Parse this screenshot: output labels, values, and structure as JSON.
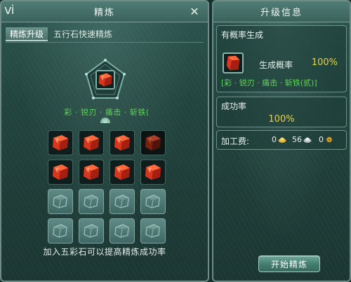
{
  "left_panel": {
    "title": "精炼",
    "tabs": [
      {
        "label": "精炼升级",
        "active": true
      },
      {
        "label": "五行石快速精炼",
        "active": false
      }
    ],
    "target_slot": {
      "item": "red-crystal-stone"
    },
    "target_text": "彩 · 锐刃 · 痛击 · 斩铁(",
    "grid": {
      "rows": [
        [
          "red-crystal-stone",
          "red-crystal-stone",
          "red-crystal-stone",
          "red-crystal-stone-dim"
        ],
        [
          "red-crystal-stone",
          "red-crystal-stone",
          "red-crystal-stone",
          "red-crystal-stone"
        ],
        [
          "empty",
          "empty",
          "empty",
          "empty"
        ],
        [
          "empty",
          "empty",
          "empty",
          "empty"
        ]
      ]
    },
    "hint": "加入五彩石可以提高精炼成功率"
  },
  "right_panel": {
    "title": "升级信息",
    "probability_section": {
      "title": "有概率生成",
      "item": "red-crystal-stone",
      "label": "生成概率",
      "value": "100%",
      "attributes": "[彩 · 锐刃 · 痛击 · 斩铁(贰)]"
    },
    "success_section": {
      "title": "成功率",
      "value": "100%"
    },
    "fee_section": {
      "label": "加工费:",
      "gold": "0",
      "silver": "56",
      "copper": "0"
    },
    "start_button": "开始精炼"
  },
  "colors": {
    "green_text": "#5fd35a",
    "yellow_text": "#e7d34a",
    "panel_bg": "#23453f"
  },
  "icons": {
    "logo": "emblem-icon",
    "close": "close-icon",
    "gem": "red-crystal-stone-icon",
    "empty_slot": "ghost-stone-icon"
  }
}
